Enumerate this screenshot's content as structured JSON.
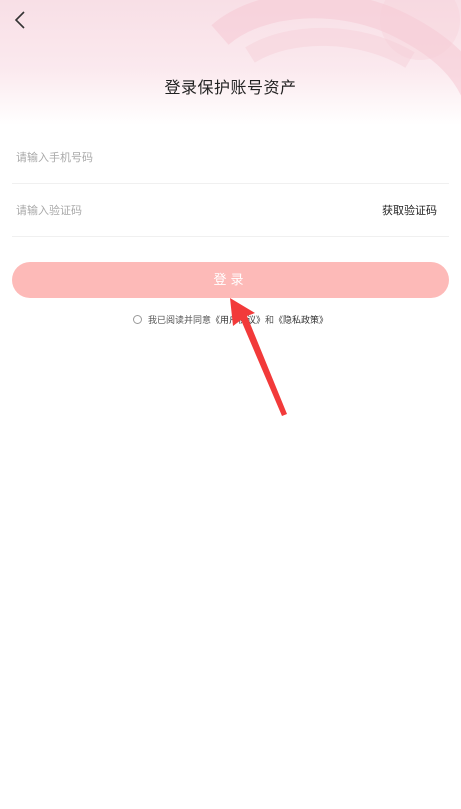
{
  "header": {
    "title": "登录保护账号资产"
  },
  "form": {
    "phone_placeholder": "请输入手机号码",
    "code_placeholder": "请输入验证码",
    "get_code_label": "获取验证码"
  },
  "login_button": {
    "label": "登录"
  },
  "agreement": {
    "prefix": "我已阅读并同意",
    "user_agreement": "《用户协议》",
    "conjunction": "和",
    "privacy_policy": "《隐私政策》"
  },
  "colors": {
    "login_button_bg": "#fdbab8",
    "annotation_arrow": "#f23a3a",
    "header_gradient_top": "#f8dfe6"
  },
  "icons": {
    "back": "chevron-left-icon",
    "agreement_checkbox": "radio-circle-icon",
    "annotation": "red-arrow-icon"
  }
}
